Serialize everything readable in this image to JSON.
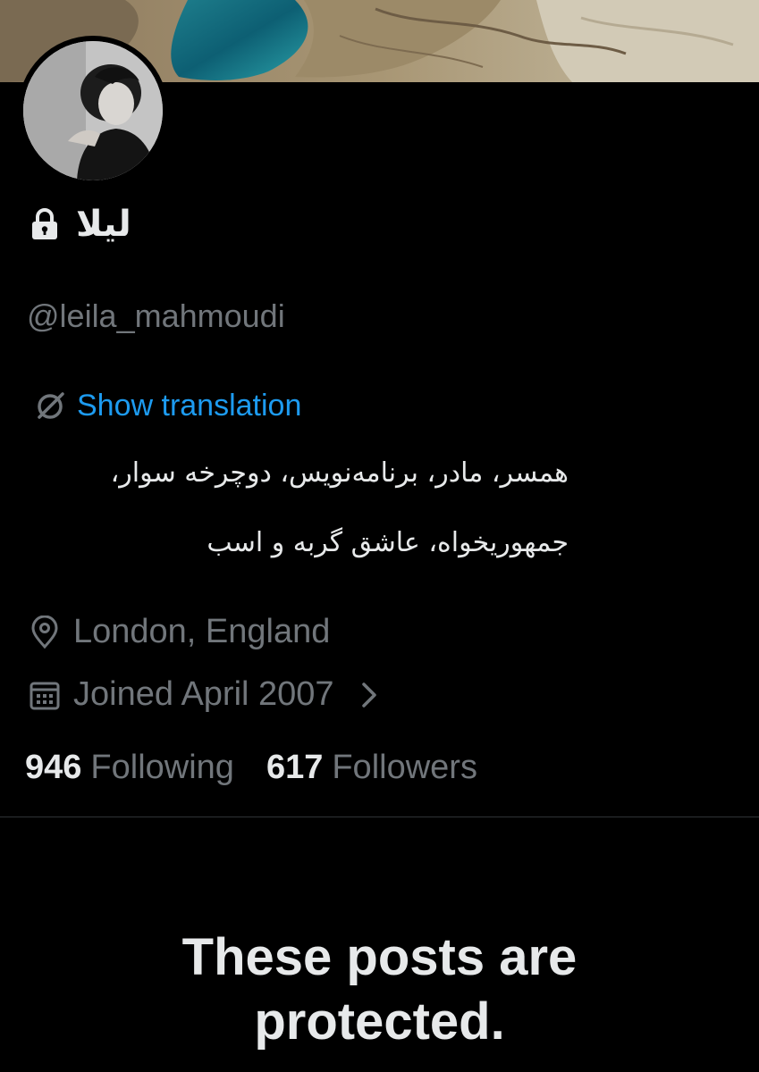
{
  "profile": {
    "display_name": "ليلا",
    "handle": "@leila_mahmoudi",
    "translate_label": "Show translation",
    "bio_lines": [
      "همسر، مادر، برنامه‌نویس، دوچرخه سوار،",
      "جمهوریخواه، عاشق گربه و اسب"
    ],
    "location": "London, England",
    "joined": "Joined April 2007",
    "following_count": "946",
    "following_label": "Following",
    "followers_count": "617",
    "followers_label": "Followers"
  },
  "protected_notice": {
    "line1": "These posts are",
    "line2": "protected."
  },
  "icons": {
    "lock": "lock-icon",
    "translate": "translate-icon",
    "location": "location-pin-icon",
    "calendar": "calendar-icon",
    "chevron": "chevron-right-icon"
  },
  "colors": {
    "background": "#000000",
    "text_primary": "#e7e9ea",
    "text_secondary": "#71767b",
    "accent": "#1d9bf0",
    "divider": "#2f3336"
  }
}
